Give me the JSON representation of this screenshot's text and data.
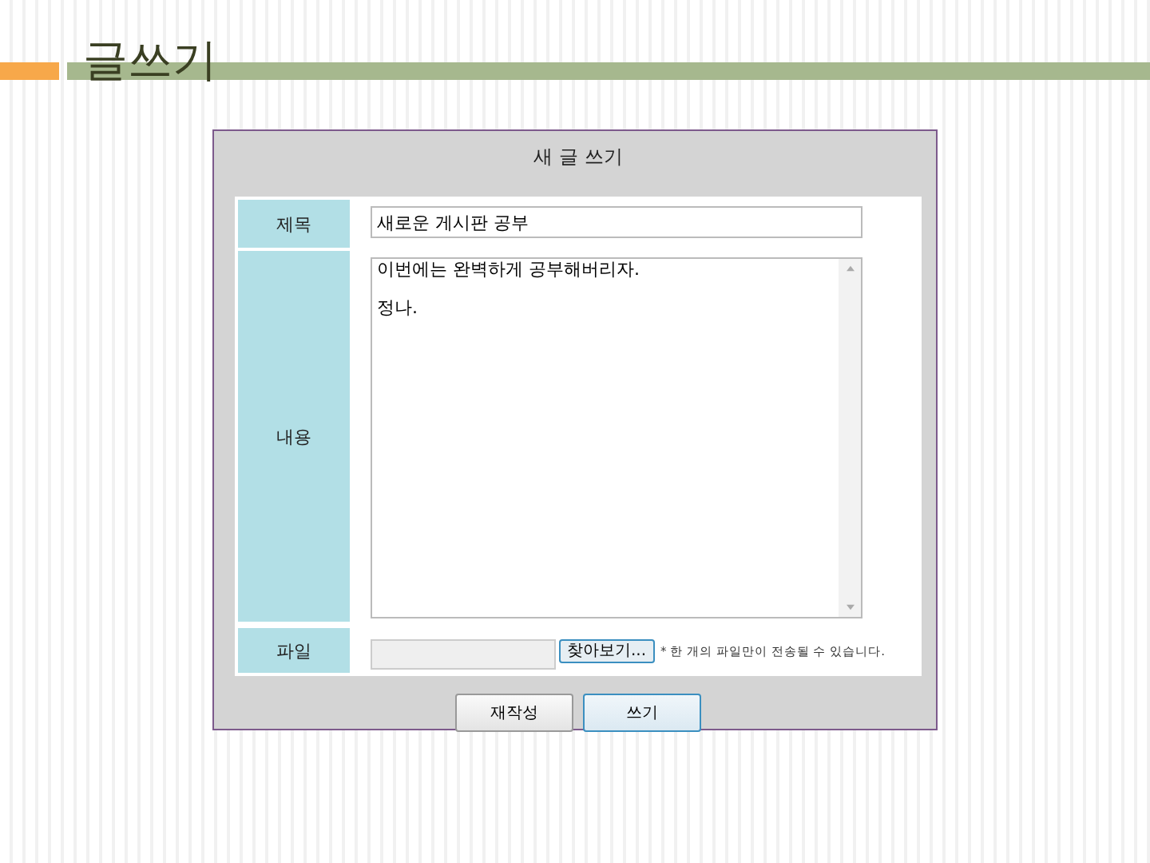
{
  "page_title": "글쓰기",
  "form": {
    "title": "새 글 쓰기",
    "rows": [
      {
        "kind": "text",
        "label": "제목",
        "value": "새로운 게시판 공부"
      },
      {
        "kind": "textarea",
        "label": "내용",
        "value": "이번에는 완벽하게 공부해버리자.\n정나."
      },
      {
        "kind": "file",
        "label": "파일",
        "button": "찾아보기...",
        "note": "* 한 개의 파일만이 전송될 수 있습니다."
      }
    ],
    "buttons": [
      "재작성",
      "쓰기"
    ]
  }
}
